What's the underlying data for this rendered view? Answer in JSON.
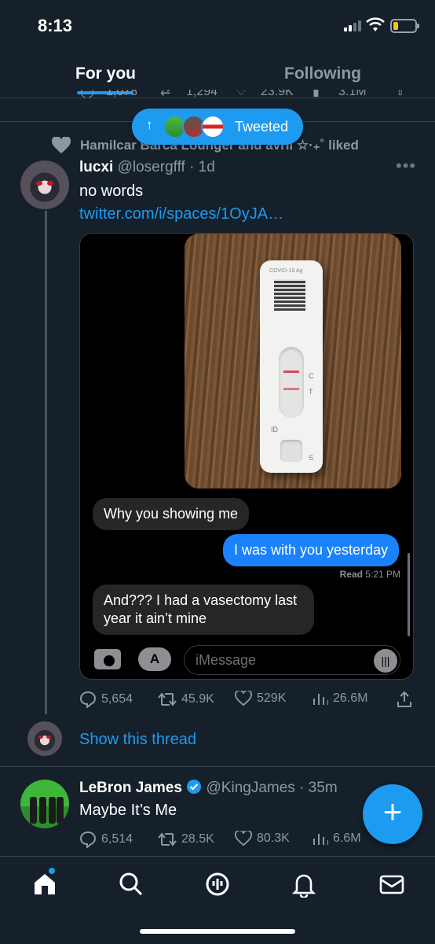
{
  "status_bar": {
    "time": "8:13"
  },
  "tabs": {
    "for_you": "For you",
    "following": "Following"
  },
  "previous_tweet_stats": {
    "replies": "1,078",
    "retweets": "1,294",
    "likes": "23.9K",
    "views": "3.1M"
  },
  "new_tweets_pill": {
    "label": "Tweeted"
  },
  "social_context": {
    "text": "Hamilcar Barca Lounger and avril ☆·₊˚ liked"
  },
  "tweet": {
    "name": "lucxi",
    "handle": "@losergfff",
    "time": "· 1d",
    "text": "no words",
    "link": "twitter.com/i/spaces/1OyJA…",
    "media": {
      "test_label": "COVID-19 Ag",
      "mark_c": "C",
      "mark_t": "T",
      "mark_id": "ID",
      "mark_s": "S",
      "messages": [
        {
          "text": "Why you showing me",
          "direction": "incoming"
        },
        {
          "text": "I was with you yesterday",
          "direction": "outgoing"
        },
        {
          "text": "And??? I had a vasectomy last year it ain’t mine",
          "direction": "incoming"
        }
      ],
      "read_label": "Read",
      "read_time": "5:21 PM",
      "input_placeholder": "iMessage"
    },
    "stats": {
      "replies": "5,654",
      "retweets": "45.9K",
      "likes": "529K",
      "views": "26.6M"
    }
  },
  "show_thread": "Show this thread",
  "next_tweet": {
    "name": "LeBron James",
    "handle": "@KingJames",
    "time": "· 35m",
    "text": "Maybe It’s Me",
    "stats": {
      "replies": "6,514",
      "retweets": "28.5K",
      "likes": "80.3K",
      "views": "6.6M"
    }
  },
  "fab_label": "+",
  "colors": {
    "accent": "#1d9bf0",
    "background": "#15202b",
    "muted": "#8b98a5",
    "imessage_blue": "#1982fc"
  },
  "icons": [
    "reply-icon",
    "retweet-icon",
    "heart-icon",
    "views-icon",
    "share-icon",
    "home-icon",
    "search-icon",
    "spaces-icon",
    "bell-icon",
    "mail-icon"
  ]
}
